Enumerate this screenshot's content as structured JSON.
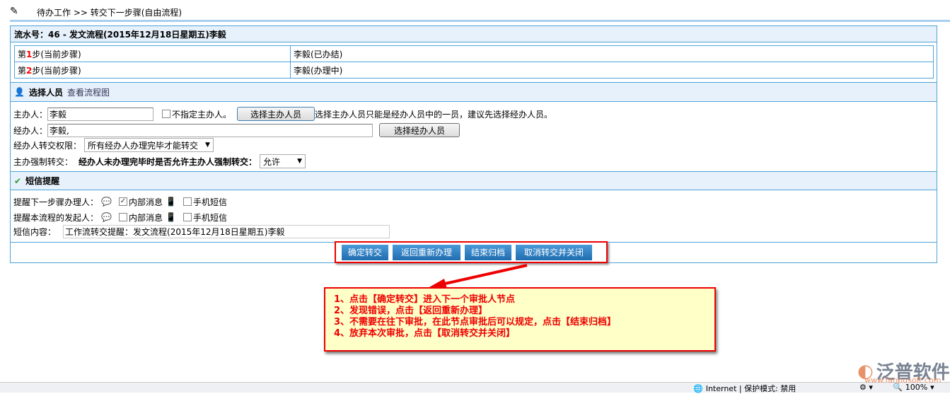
{
  "breadcrumb": {
    "text": "待办工作 >> 转交下一步骤(自由流程)"
  },
  "flow_title": "流水号：46 - 发文流程(2015年12月18日星期五)李毅",
  "steps": [
    {
      "prefix": "第",
      "num": "1",
      "suffix": "步(当前步骤)",
      "person": "李毅(已办结)"
    },
    {
      "prefix": "第",
      "num": "2",
      "suffix": "步(当前步骤)",
      "person": "李毅(办理中)"
    }
  ],
  "select_section": {
    "title": "选择人员",
    "link": "查看流程图"
  },
  "form": {
    "host_label": "主办人：",
    "host_value": "李毅",
    "no_host_label": "不指定主办人。",
    "select_host_btn": "选择主办人员",
    "host_hint": "选择主办人员只能是经办人员中的一员，建议先选择经办人员。",
    "handler_label": "经办人：",
    "handler_value": "李毅,",
    "select_handler_btn": "选择经办人员",
    "perm_label": "经办人转交权限：",
    "perm_value": "所有经办人办理完毕才能转交",
    "force_label": "主办强制转交：",
    "force_question": "经办人未办理完毕时是否允许主办人强制转交：",
    "force_value": "允许"
  },
  "sms_section": {
    "title": "短信提醒"
  },
  "sms": {
    "next_label": "提醒下一步骤办理人：",
    "creator_label": "提醒本流程的发起人：",
    "internal": "内部消息",
    "mobile": "手机短信",
    "next_internal_checked": true,
    "content_label": "短信内容：",
    "content_value": "工作流转交提醒：发文流程(2015年12月18日星期五)李毅"
  },
  "buttons": {
    "confirm": "确定转交",
    "return": "返回重新办理",
    "archive": "结束归档",
    "cancel": "取消转交并关闭"
  },
  "callout": [
    "1、点击【确定转交】进入下一个审批人节点",
    "2、发现错误，点击【返回重新办理】",
    "3、不需要在往下审批，在此节点审批后可以规定，点击【结束归档】",
    "4、放弃本次审批，点击【取消转交并关闭】"
  ],
  "watermark": {
    "brand": "泛普软件",
    "url": "www.fanpusoft.com"
  },
  "statusbar": {
    "zone": "Internet | 保护模式: 禁用",
    "zoom": "100%"
  }
}
